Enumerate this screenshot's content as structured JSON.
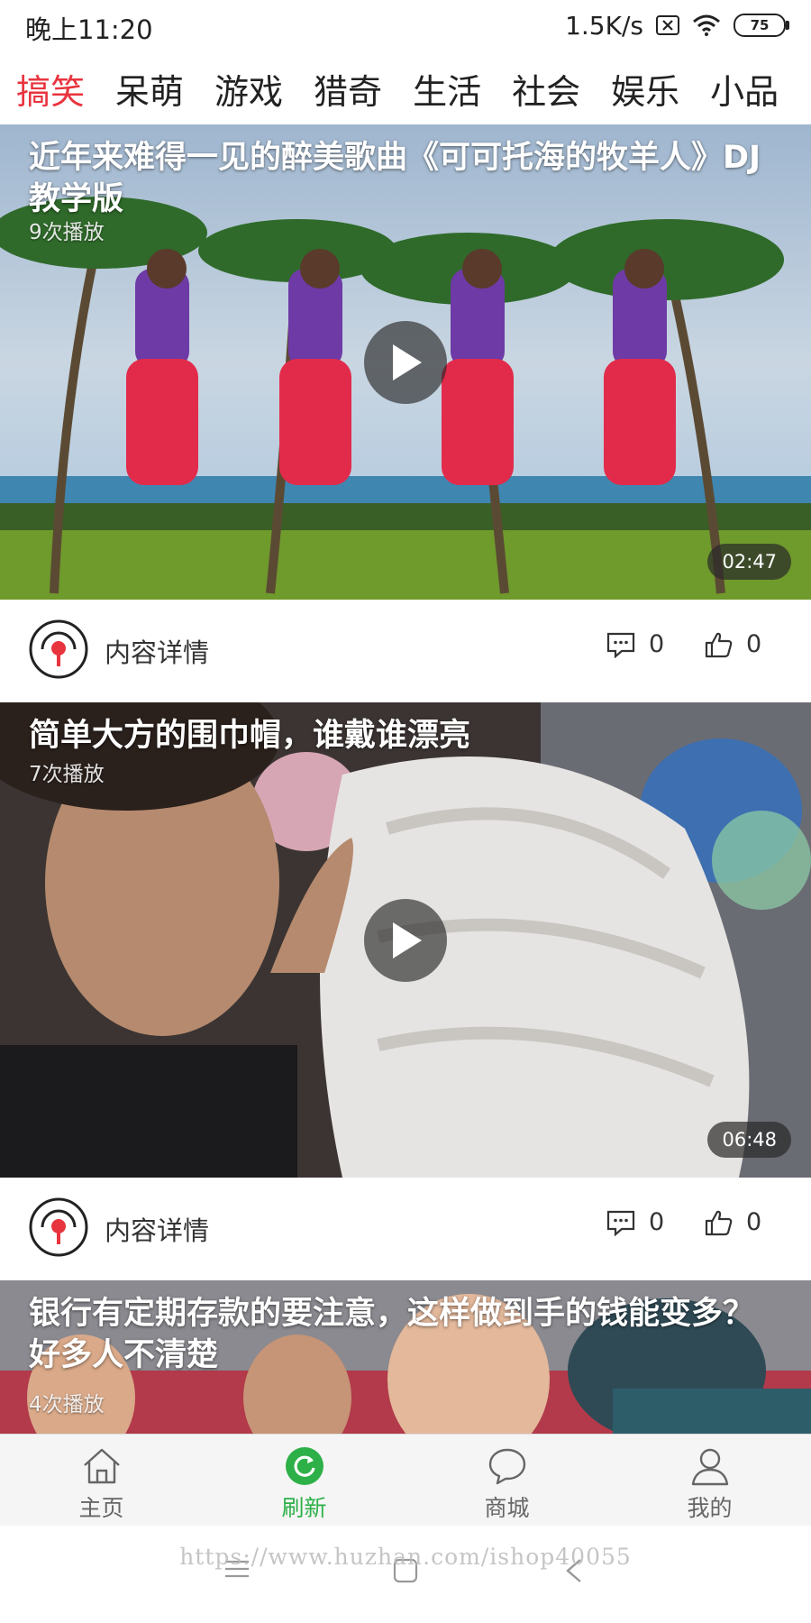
{
  "status_bar": {
    "time": "晚上11:20",
    "net_speed": "1.5K/s",
    "battery": "75",
    "icons": [
      "sim-x-icon",
      "wifi-icon",
      "battery-icon"
    ]
  },
  "tabs": [
    {
      "label": "搞笑",
      "active": true
    },
    {
      "label": "呆萌"
    },
    {
      "label": "游戏"
    },
    {
      "label": "猎奇"
    },
    {
      "label": "生活"
    },
    {
      "label": "社会"
    },
    {
      "label": "娱乐"
    },
    {
      "label": "小品"
    }
  ],
  "videos": [
    {
      "title": "近年来难得一见的醉美歌曲《可可托海的牧羊人》DJ教学版",
      "plays": "9次播放",
      "duration": "02:47",
      "detail_label": "内容详情",
      "comments": "0",
      "likes": "0"
    },
    {
      "title": "简单大方的围巾帽，谁戴谁漂亮",
      "plays": "7次播放",
      "duration": "06:48",
      "detail_label": "内容详情",
      "comments": "0",
      "likes": "0"
    },
    {
      "title": "银行有定期存款的要注意，这样做到手的钱能变多？好多人不清楚",
      "plays": "4次播放"
    }
  ],
  "bottom_nav": [
    {
      "label": "主页",
      "icon": "home-icon"
    },
    {
      "label": "刷新",
      "icon": "refresh-icon",
      "active": true
    },
    {
      "label": "商城",
      "icon": "chat-bubble-icon"
    },
    {
      "label": "我的",
      "icon": "user-icon"
    }
  ],
  "watermark": "https://www.huzhan.com/ishop40055",
  "colors": {
    "accent_red": "#e8343e",
    "active_green": "#2eb048"
  }
}
